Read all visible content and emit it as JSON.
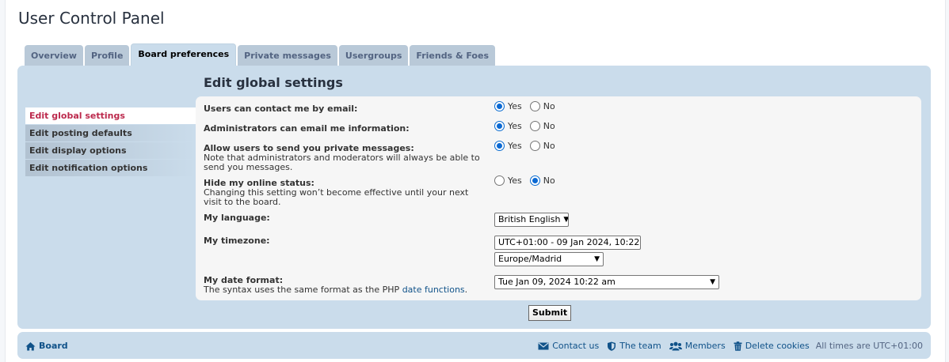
{
  "page_title": "User Control Panel",
  "tabs": [
    {
      "label": "Overview"
    },
    {
      "label": "Profile"
    },
    {
      "label": "Board preferences",
      "active": true
    },
    {
      "label": "Private messages"
    },
    {
      "label": "Usergroups"
    },
    {
      "label": "Friends & Foes"
    }
  ],
  "sidebar": [
    {
      "label": "Edit global settings",
      "active": true
    },
    {
      "label": "Edit posting defaults"
    },
    {
      "label": "Edit display options"
    },
    {
      "label": "Edit notification options"
    }
  ],
  "section_title": "Edit global settings",
  "settings": {
    "email": {
      "label": "Users can contact me by email:",
      "yes": "Yes",
      "no": "No",
      "value": "yes"
    },
    "admin_email": {
      "label": "Administrators can email me information:",
      "yes": "Yes",
      "no": "No",
      "value": "yes"
    },
    "pm": {
      "label": "Allow users to send you private messages:",
      "desc": "Note that administrators and moderators will always be able to send you messages.",
      "yes": "Yes",
      "no": "No",
      "value": "yes"
    },
    "online": {
      "label": "Hide my online status:",
      "desc": "Changing this setting won’t become effective until your next visit to the board.",
      "yes": "Yes",
      "no": "No",
      "value": "no"
    },
    "language": {
      "label": "My language:",
      "value": "British English"
    },
    "timezone": {
      "label": "My timezone:",
      "value": "UTC+01:00 - 09 Jan 2024, 10:22",
      "zone": "Europe/Madrid"
    },
    "dateformat": {
      "label": "My date format:",
      "desc_prefix": "The syntax uses the same format as the PHP ",
      "link": "date functions",
      "desc_suffix": ".",
      "value": "Tue Jan 09, 2024 10:22 am"
    }
  },
  "submit_label": "Submit",
  "footer": {
    "board": "Board",
    "contact": "Contact us",
    "team": "The team",
    "members": "Members",
    "delete_cookies": "Delete cookies",
    "times": "All times are UTC+01:00"
  },
  "colors": {
    "panel": "#cadceb",
    "accent": "#bc2a4d",
    "link": "#105289"
  }
}
